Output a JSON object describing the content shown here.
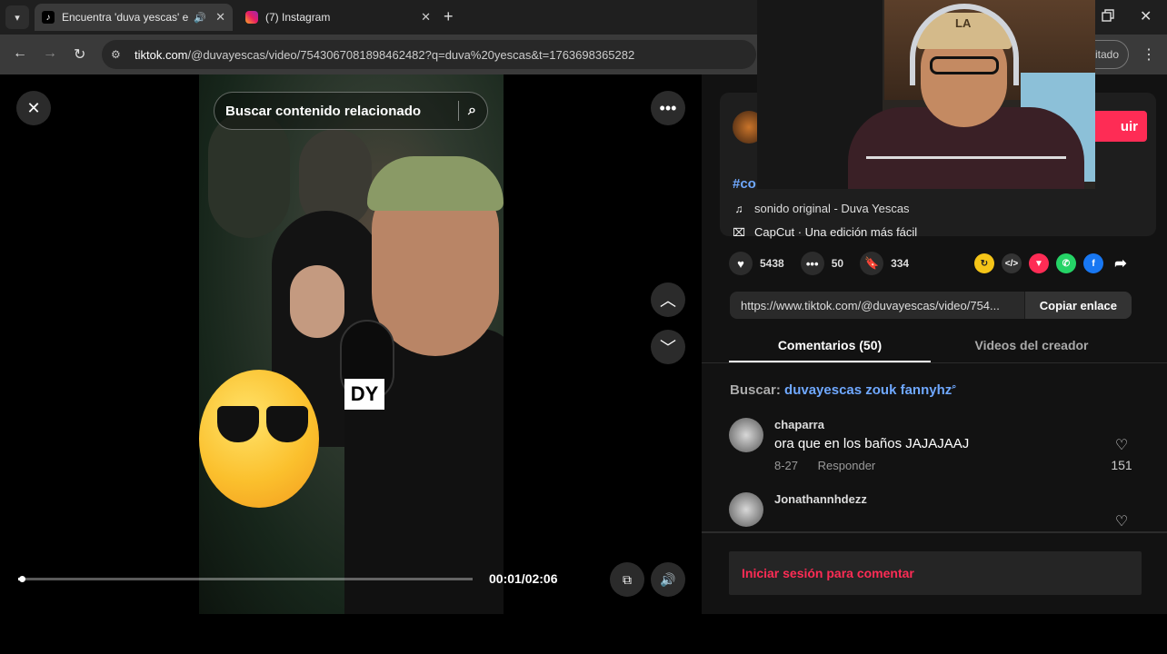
{
  "browser": {
    "tabs": [
      {
        "title": "Encuentra 'duva yescas' en",
        "favicon": "tiktok-icon",
        "active": true,
        "audio": true
      },
      {
        "title": "(7) Instagram",
        "favicon": "instagram-icon",
        "active": false,
        "audio": false
      }
    ],
    "url_host": "tiktok.com",
    "url_rest": "/@duvayescas/video/7543067081898462482?q=duva%20yescas&t=1763698365282",
    "profile_label": "itado"
  },
  "video": {
    "search_placeholder": "Buscar contenido relacionado",
    "mic_label": "DY",
    "progress": 0.008,
    "time_readout": "00:01/02:06"
  },
  "panel": {
    "follow_label": "uir",
    "hashtag": "#co",
    "music": "sonido original - Duva Yescas",
    "capcut": "CapCut · Una edición más fácil",
    "stats": {
      "likes": "5438",
      "comments": "50",
      "saves": "334"
    },
    "share_icons": [
      "repost-icon",
      "embed-icon",
      "send-icon",
      "whatsapp-icon",
      "facebook-icon",
      "share-arrow-icon"
    ],
    "link_url": "https://www.tiktok.com/@duvayescas/video/754...",
    "copy_link_label": "Copiar enlace",
    "tabs": [
      "Comentarios (50)",
      "Videos del creador"
    ],
    "search_prefix": "Buscar:",
    "search_term": "duvayescas zouk fannyhz",
    "comments": [
      {
        "user": "chaparra",
        "text": "ora que en los baños JAJAJAAJ",
        "date": "8-27",
        "reply": "Responder",
        "likes": "151"
      },
      {
        "user": "Jonathannhdezz",
        "text": "",
        "date": "",
        "reply": "",
        "likes": ""
      }
    ],
    "login_prompt": "Iniciar sesión para comentar"
  },
  "webcam": {
    "cap_logo": "LA"
  },
  "colors": {
    "accent": "#fe2c55",
    "link": "#6fa8ff",
    "panel_bg": "#121212"
  }
}
